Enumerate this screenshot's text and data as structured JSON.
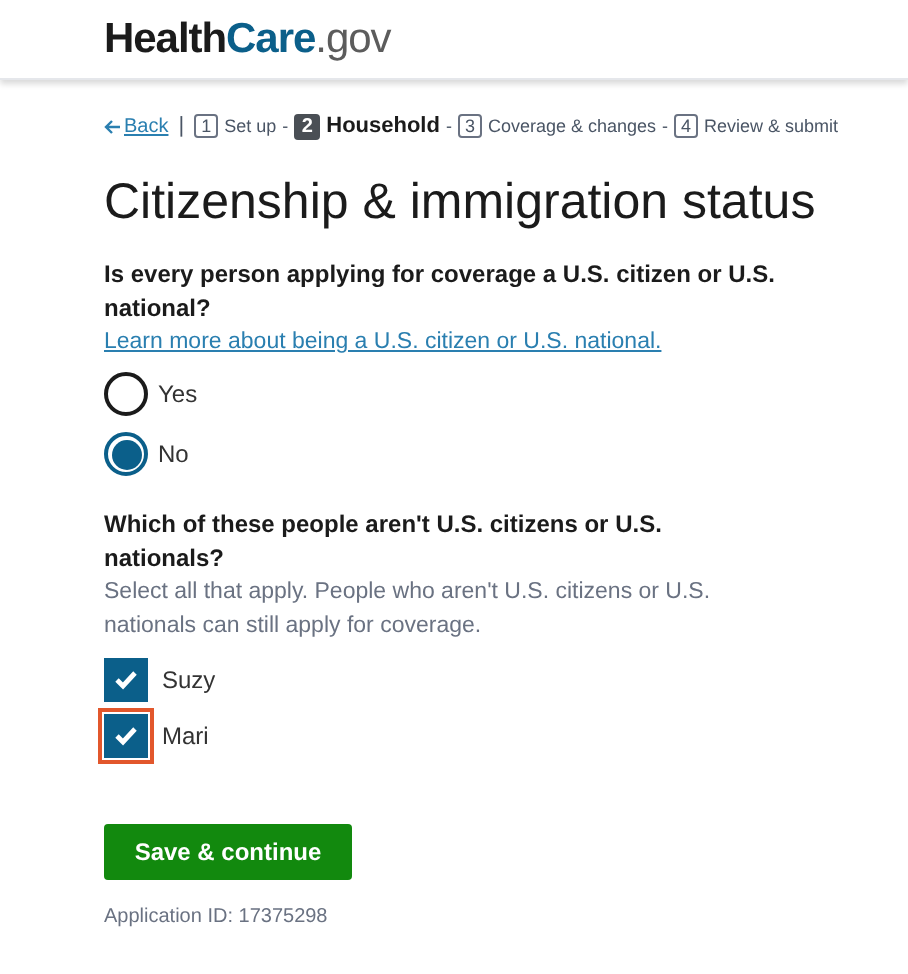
{
  "header": {
    "logo": [
      {
        "text": "Health",
        "color": "#1b1b1b"
      },
      {
        "text": "Care",
        "color": "#0b5f8a"
      },
      {
        "text": ".gov",
        "color": "#5c5c5c"
      }
    ]
  },
  "nav": {
    "back": "Back",
    "divider": "|",
    "steps": [
      {
        "number": "1",
        "label": "Set up",
        "selected": false,
        "separator": "-"
      },
      {
        "number": "2",
        "label": "Household",
        "selected": true,
        "separator": "-"
      },
      {
        "number": "3",
        "label": "Coverage & changes",
        "selected": false,
        "separator": "-"
      },
      {
        "number": "4",
        "label": "Review & submit",
        "selected": false
      }
    ]
  },
  "title": "Citizenship & immigration status",
  "question_1": {
    "label": "Is every person applying for coverage a U.S. citizen or U.S. national?",
    "link": "Learn more about being a U.S. citizen or U.S. national.",
    "options": [
      {
        "label": "Yes",
        "selected": false
      },
      {
        "label": "No",
        "selected": true
      }
    ]
  },
  "question_2": {
    "label": "Which of these people aren't U.S. citizens or U.S. nationals?",
    "hint": "Select all that apply. People who aren't U.S. citizens or U.S. nationals can still apply for coverage.",
    "options": [
      {
        "label": "Suzy",
        "checked": true,
        "focused": false
      },
      {
        "label": "Mari",
        "checked": true,
        "focused": true
      }
    ]
  },
  "button": "Save & continue",
  "application_id": "Application ID: 17375298"
}
